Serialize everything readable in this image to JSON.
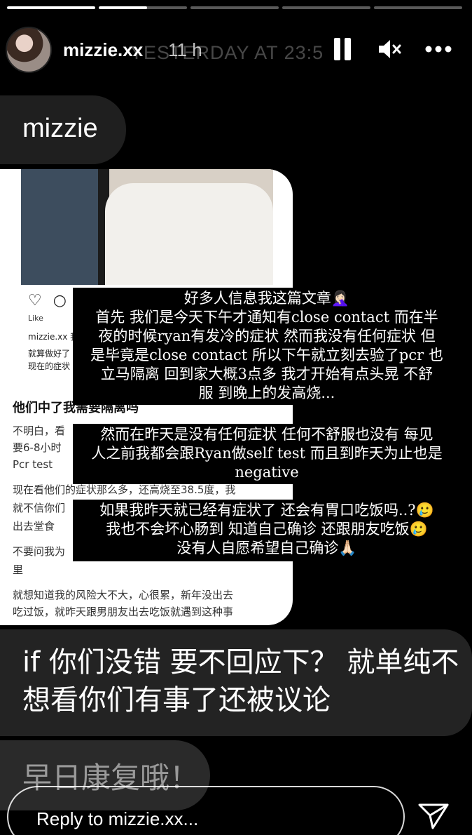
{
  "progress": [
    1,
    0.55,
    0,
    0,
    0
  ],
  "header": {
    "username": "mizzie.xx",
    "time": "11 h",
    "ghost_text": "YESTERDAY AT 23:5",
    "icons": [
      "pause-icon",
      "mute-icon",
      "more-icon"
    ]
  },
  "bubble_top": "mizzie",
  "card": {
    "likes": "Like",
    "line1": "mizzie.xx 我",
    "line2": "就算做好了",
    "line3": "现在的症状",
    "heading": "他们中了我需要隔离吗",
    "t1": "不明白，看",
    "t2": "要6-8小时",
    "t3": "Pcr test",
    "t4": "现在看他们的症状那么多，还高烧至38.5度，我",
    "t5": "就不信你们",
    "t6": "出去堂食",
    "t7": "不要问我为",
    "t8": "里",
    "t9": "就想知道我的风险大不大，心很累，新年没出去",
    "t10": "吃过饭，就昨天跟男朋友出去吃饭就遇到这种事"
  },
  "overlay1": {
    "l1": "好多人信息我这篇文章🤦🏻‍♀️",
    "l2": "首先 我们是今天下午才通知有close contact 而在半",
    "l3": "夜的时候ryan有发冷的症状 然而我没有任何症状 但",
    "l4": "是毕竟是close contact 所以下午就立刻去验了pcr 也",
    "l5": "立马隔离 回到家大概3点多 我才开始有点头晃 不舒",
    "l6": "服 到晚上的发高烧..."
  },
  "overlay2": {
    "l1": "然而在昨天是没有任何症状 任何不舒服也没有 每见",
    "l2": "人之前我都会跟Ryan做self test 而且到昨天为止也是",
    "l3": "negative"
  },
  "overlay3": {
    "l1": "如果我昨天就已经有症状了 还会有胃口吃饭吗..?🥲",
    "l2": "我也不会坏心肠到 知道自己确诊 还跟朋友吃饭🥲",
    "l3": "没有人自愿希望自己确诊🙏🏻"
  },
  "bubble_mid": "if 你们没错 要不回应下？ 就单纯不想看你们有事了还被议论",
  "bubble_low": "早日康复哦！",
  "reply_placeholder": "Reply to mizzie.xx...",
  "send_icon": "send-icon"
}
